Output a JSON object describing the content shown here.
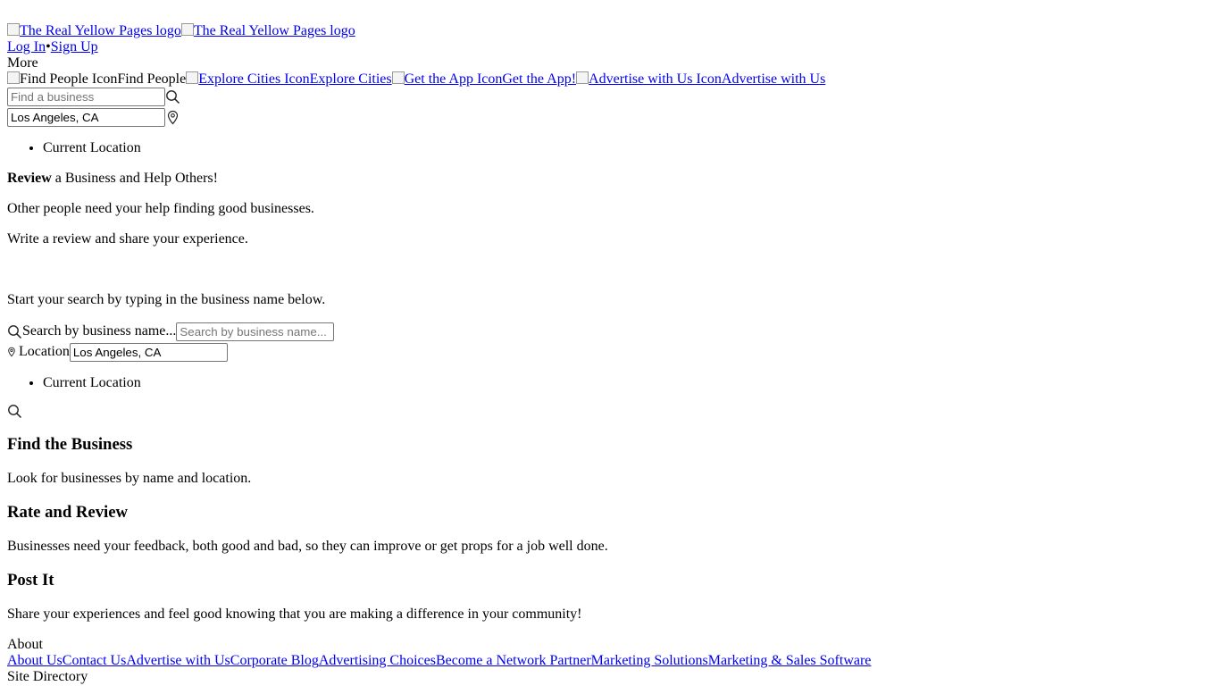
{
  "header": {
    "logo_alt_1": "The Real Yellow Pages logo",
    "logo_alt_2": "The Real Yellow Pages logo",
    "login_label": "Log In",
    "separator": "•",
    "signup_label": "Sign Up",
    "more_label": "More",
    "nav": [
      {
        "icon_alt": "Find People Icon",
        "label": "Find People"
      },
      {
        "icon_alt": "Explore Cities Icon",
        "label": "Explore Cities"
      },
      {
        "icon_alt": "Get the App Icon",
        "label": "Get the App!"
      },
      {
        "icon_alt": "Advertise with Us Icon",
        "label": "Advertise with Us"
      }
    ],
    "search_placeholder": "Find a business",
    "location_value": "Los Angeles, CA",
    "current_location_label": "Current Location"
  },
  "intro": {
    "headline_bold": "Review",
    "headline_rest": " a Business and Help Others!",
    "line1": "Other people need your help finding good businesses.",
    "line2": "Write a review and share your experience.",
    "instruction": "Start your search by typing in the business name below."
  },
  "review_search": {
    "business_label": "Search by business name...",
    "business_placeholder": "Search by business name...",
    "location_label": "Location",
    "location_value": "Los Angeles, CA",
    "current_location_label": "Current Location"
  },
  "steps": [
    {
      "title": "Find the Business",
      "text": "Look for businesses by name and location."
    },
    {
      "title": "Rate and Review",
      "text": "Businesses need your feedback, both good and bad, so they can improve or get props for a job well done."
    },
    {
      "title": "Post It",
      "text": "Share your experiences and feel good knowing that you are making a difference in your community!"
    }
  ],
  "footer": {
    "about_heading": "About",
    "links": [
      "About Us",
      "Contact Us",
      "Advertise with Us",
      "Corporate Blog",
      "Advertising Choices",
      "Become a Network Partner",
      "Marketing Solutions",
      "Marketing & Sales Software"
    ],
    "site_directory_label": "Site Directory"
  },
  "colors": {
    "link": "#0000ee",
    "text": "#000000",
    "background": "#ffffff"
  }
}
